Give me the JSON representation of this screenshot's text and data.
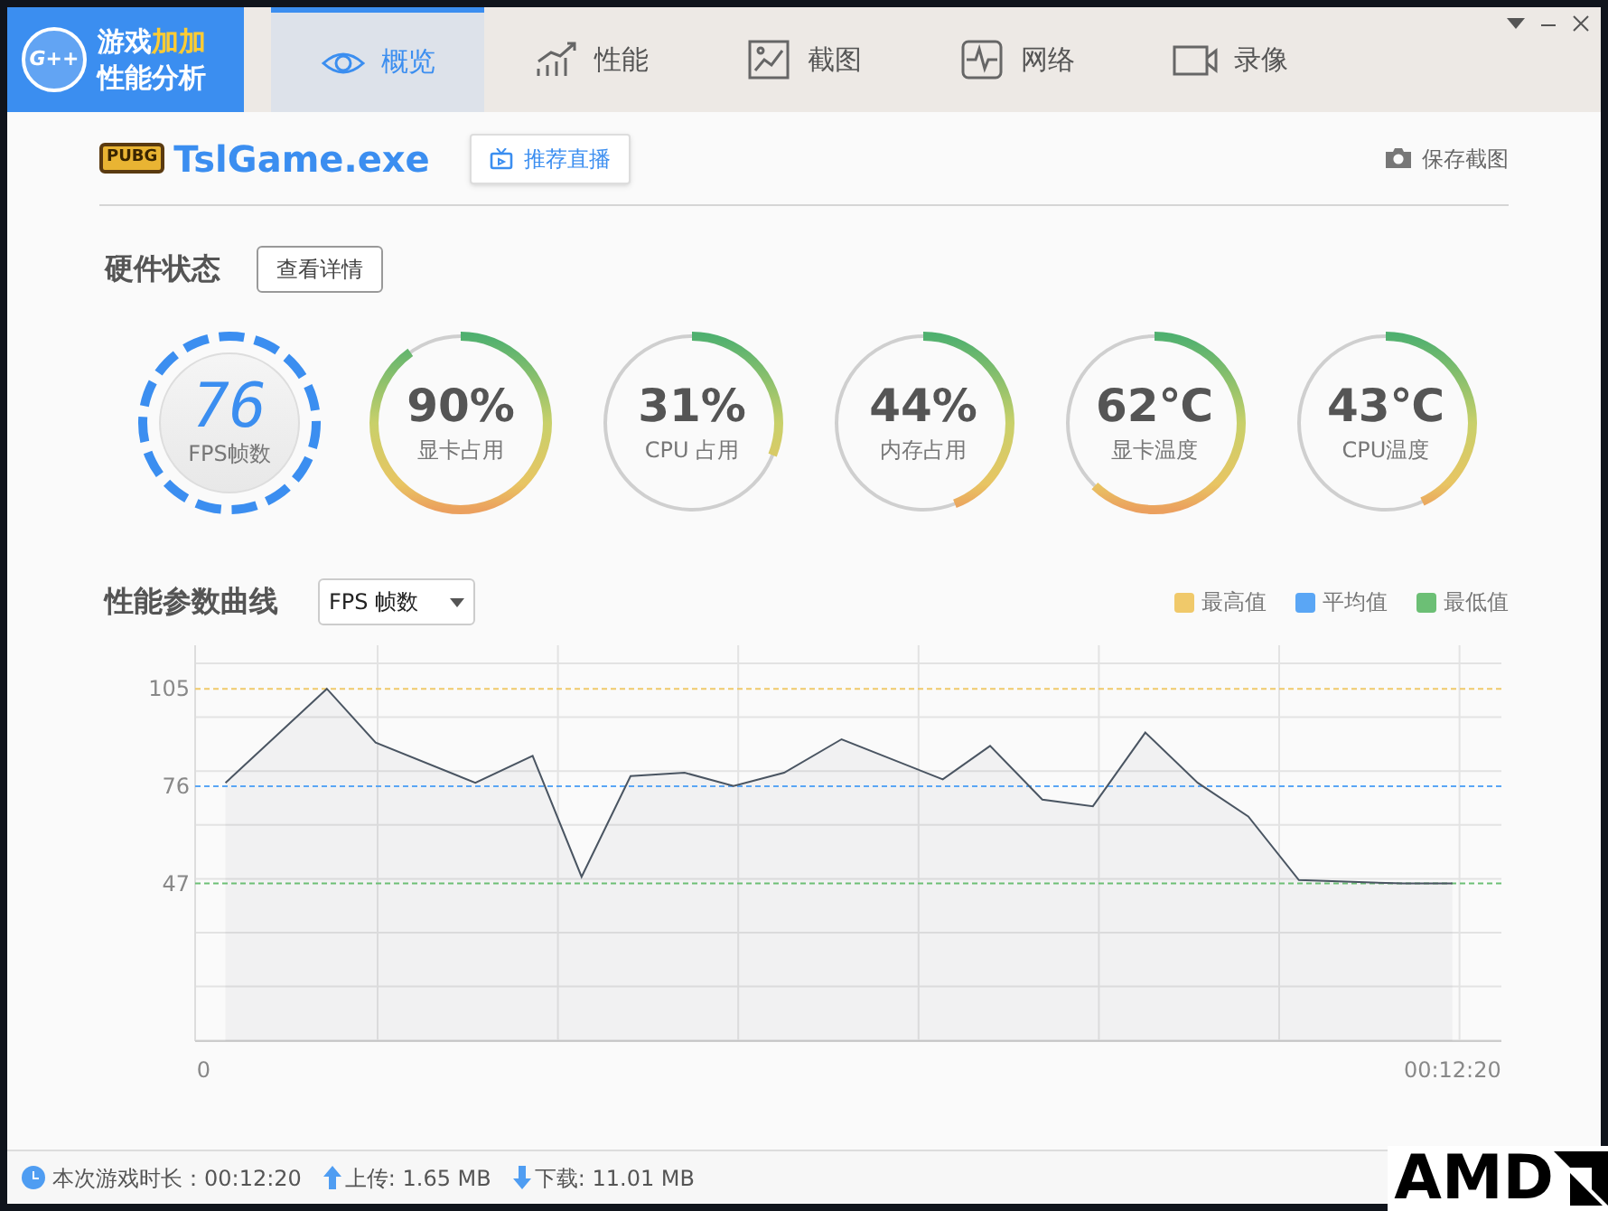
{
  "app": {
    "logo_badge": "G++",
    "title_line_1": "游戏",
    "title_highlight": "加加",
    "title_line_2": "性能分析"
  },
  "tabs": [
    {
      "label": "概览",
      "selected": true
    },
    {
      "label": "性能",
      "selected": false
    },
    {
      "label": "截图",
      "selected": false
    },
    {
      "label": "网络",
      "selected": false
    },
    {
      "label": "录像",
      "selected": false
    }
  ],
  "game": {
    "badge": "PUBG",
    "name": "TslGame.exe",
    "recommend_button": "推荐直播",
    "save_button": "保存截图"
  },
  "hardware": {
    "title": "硬件状态",
    "details_button": "查看详情",
    "gauges": [
      {
        "kind": "fps",
        "value": "76",
        "label": "FPS帧数"
      },
      {
        "kind": "ring",
        "value": "90%",
        "label": "显卡占用",
        "level": 0.9
      },
      {
        "kind": "ring",
        "value": "31%",
        "label": "CPU 占用",
        "level": 0.31
      },
      {
        "kind": "ring",
        "value": "44%",
        "label": "内存占用",
        "level": 0.44
      },
      {
        "kind": "ring",
        "value": "62℃",
        "label": "显卡温度",
        "level": 0.62
      },
      {
        "kind": "ring",
        "value": "43℃",
        "label": "CPU温度",
        "level": 0.43
      }
    ]
  },
  "curve": {
    "title": "性能参数曲线",
    "metric_select": "FPS 帧数",
    "legend": [
      {
        "label": "最高值",
        "color": "#f0c96a"
      },
      {
        "label": "平均值",
        "color": "#5aa6f5"
      },
      {
        "label": "最低值",
        "color": "#6cbf75"
      }
    ],
    "chart_data": {
      "type": "area",
      "x": [
        13,
        73,
        102,
        161,
        195,
        224,
        253,
        285,
        314,
        344,
        378,
        438,
        466,
        497,
        527,
        558,
        589,
        619,
        649,
        711,
        740
      ],
      "series": [
        {
          "color": "#4a5562",
          "values": [
            77,
            105,
            89,
            77,
            85,
            49,
            79,
            80,
            76,
            80,
            90,
            78,
            88,
            72,
            70,
            92,
            77,
            67,
            48,
            47,
            47
          ]
        }
      ],
      "xlim": [
        -5,
        769
      ],
      "ylim": [
        0,
        118
      ],
      "xticks": [
        {
          "value": 0,
          "label": "0"
        },
        {
          "value": 740,
          "label": "00:12:20"
        }
      ],
      "yticks": [
        47,
        76,
        105
      ],
      "ref_lines": [
        {
          "axis": "y",
          "value": 105,
          "color": "#f0c96a"
        },
        {
          "axis": "y",
          "value": 76,
          "color": "#5aa6f5"
        },
        {
          "axis": "y",
          "value": 47,
          "color": "#6cbf75"
        }
      ]
    }
  },
  "status_bar": {
    "duration": "本次游戏时长：00:12:20",
    "upload": "上传: 1.65 MB",
    "download": "下载: 11.01 MB",
    "overlay_logo": "AMD"
  }
}
